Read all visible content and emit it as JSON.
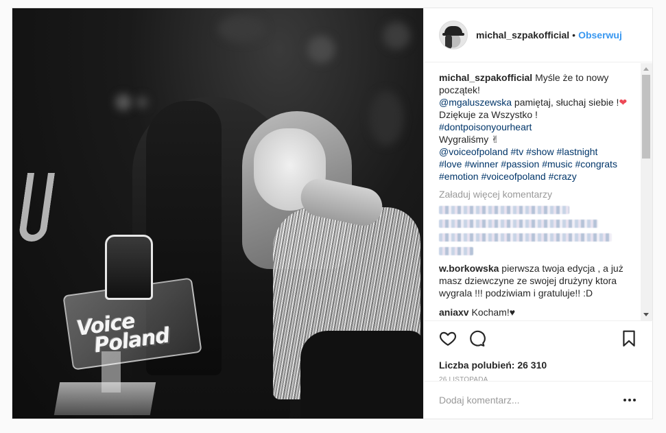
{
  "post": {
    "photo": {
      "trophy_line1": "Voice",
      "trophy_line2": "Poland"
    },
    "header": {
      "username": "michal_szpakofficial",
      "separator": "•",
      "follow_label": "Obserwuj"
    },
    "caption": {
      "username": "michal_szpakofficial",
      "text_line1": "Myśle że to nowy początek!",
      "mention1": "@mgaluszewska",
      "text_line2": "pamiętaj, słuchaj siebie !",
      "heart": "❤",
      "text_line3": "Dziękuje za Wszystko !",
      "hashtag_line1": "#dontpoisonyourheart",
      "text_line4": "Wygraliśmy",
      "victory": "✌",
      "mention2": "@voiceofpoland",
      "hashtags_a": [
        "#tv",
        "#show",
        "#lastnight"
      ],
      "hashtags_b": [
        "#love",
        "#winner",
        "#passion",
        "#music",
        "#congrats"
      ],
      "hashtags_c": [
        "#emotion",
        "#voiceofpoland",
        "#crazy"
      ]
    },
    "load_more_label": "Załaduj więcej komentarzy",
    "comments": [
      {
        "username": "w.borkowska",
        "text": "pierwsza twoja edycja , a już masz dziewczyne ze swojej drużyny ktora wygrala !!! podziwiam i gratuluje!! :D"
      },
      {
        "username": "aniaxv",
        "text": "Kocham!♥"
      }
    ],
    "likes": {
      "label": "Liczba polubień:",
      "count": "26 310"
    },
    "date": "26 LISTOPADA",
    "add_comment": {
      "placeholder": "Dodaj komentarz..."
    },
    "icons": {
      "like": "heart-icon",
      "comment": "comment-icon",
      "save": "bookmark-icon",
      "more": "more-options-icon"
    },
    "colors": {
      "link": "#3897f0",
      "hashtag": "#003569",
      "heart": "#ed4956",
      "muted": "#999999"
    }
  }
}
